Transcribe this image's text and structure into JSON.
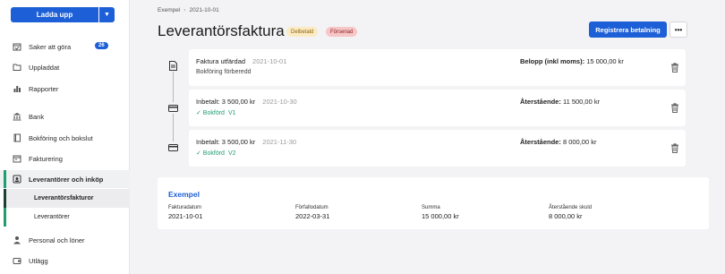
{
  "sidebar": {
    "upload_label": "Ladda upp",
    "items": [
      {
        "label": "Saker att göra",
        "badge": "26",
        "icon": "calendar-check-icon"
      },
      {
        "label": "Uppladdat",
        "icon": "folder-icon"
      },
      {
        "label": "Rapporter",
        "icon": "bar-chart-icon"
      },
      {
        "label": "Bank",
        "icon": "bank-icon"
      },
      {
        "label": "Bokföring och bokslut",
        "icon": "book-icon"
      },
      {
        "label": "Fakturering",
        "icon": "invoice-icon"
      },
      {
        "label": "Leverantörer och inköp",
        "icon": "supplier-icon"
      },
      {
        "label": "Personal och löner",
        "icon": "person-icon"
      },
      {
        "label": "Utlägg",
        "icon": "wallet-icon"
      }
    ],
    "subitems": [
      {
        "label": "Leverantörsfakturor"
      },
      {
        "label": "Leverantörer"
      }
    ]
  },
  "breadcrumb": {
    "root": "Exempel",
    "separator": "›",
    "current": "2021-10-01"
  },
  "header": {
    "title": "Leverantörsfaktura",
    "tags": [
      {
        "label": "Delbetald",
        "color": "#fbeac2"
      },
      {
        "label": "Försenad",
        "color": "#f7c6c6"
      }
    ],
    "register_button": "Registrera betalning",
    "more_button": "•••"
  },
  "events": [
    {
      "title": "Faktura utfärdad",
      "date": "2021-10-01",
      "subtitle": "Bokföring förberedd",
      "right_label": "Belopp (inkl moms):",
      "right_value": "15 000,00 kr",
      "icon": "document-icon"
    },
    {
      "title": "Inbetalt: 3 500,00 kr",
      "date": "2021-10-30",
      "status": "✓ Bokförd",
      "voucher": "V1",
      "right_label": "Återstående:",
      "right_value": "11 500,00 kr",
      "icon": "credit-card-icon"
    },
    {
      "title": "Inbetalt: 3 500,00 kr",
      "date": "2021-11-30",
      "status": "✓ Bokförd",
      "voucher": "V2",
      "right_label": "Återstående:",
      "right_value": "8 000,00 kr",
      "icon": "credit-card-icon"
    }
  ],
  "details": {
    "title": "Exempel",
    "fields": [
      {
        "label": "Fakturadatum",
        "value": "2021-10-01"
      },
      {
        "label": "Förfallodatum",
        "value": "2022-03-31"
      },
      {
        "label": "Summa",
        "value": "15 000,00 kr"
      },
      {
        "label": "Återstående skuld",
        "value": "8 000,00 kr"
      }
    ]
  },
  "colors": {
    "accent": "#1d5fd6",
    "active_marker": "#1f9e6e",
    "success": "#1f9e6e"
  }
}
